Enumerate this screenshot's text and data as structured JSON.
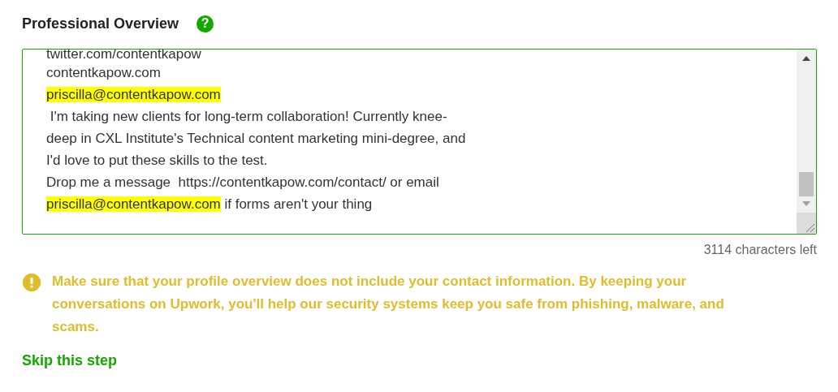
{
  "section": {
    "title": "Professional Overview",
    "help_icon": "?"
  },
  "overview_field": {
    "lines": [
      [
        {
          "text": "twitter.com/contentkapow",
          "highlighted": false
        }
      ],
      [
        {
          "text": "contentkapow.com",
          "highlighted": false
        }
      ],
      [
        {
          "text": "priscilla@contentkapow.com",
          "highlighted": true
        }
      ],
      [
        {
          "text": " I'm taking new clients for long-term collaboration! Currently knee-",
          "highlighted": false
        }
      ],
      [
        {
          "text": "deep in CXL Institute's Technical content marketing mini-degree, and",
          "highlighted": false
        }
      ],
      [
        {
          "text": "I'd love to put these skills to the test.",
          "highlighted": false
        }
      ],
      [
        {
          "text": "Drop me a message  https://contentkapow.com/contact/ or email",
          "highlighted": false
        }
      ],
      [
        {
          "text": "priscilla@contentkapow.com",
          "highlighted": true
        },
        {
          "text": " if forms aren't your thing",
          "highlighted": false
        }
      ]
    ],
    "characters_left": "3114 characters left"
  },
  "warning": {
    "text": " Make sure that your profile overview does not include your contact information. By keeping your conversations on Upwork, you'll help our security systems keep you safe from phishing, malware, and scams."
  },
  "skip_link": "Skip this step"
}
